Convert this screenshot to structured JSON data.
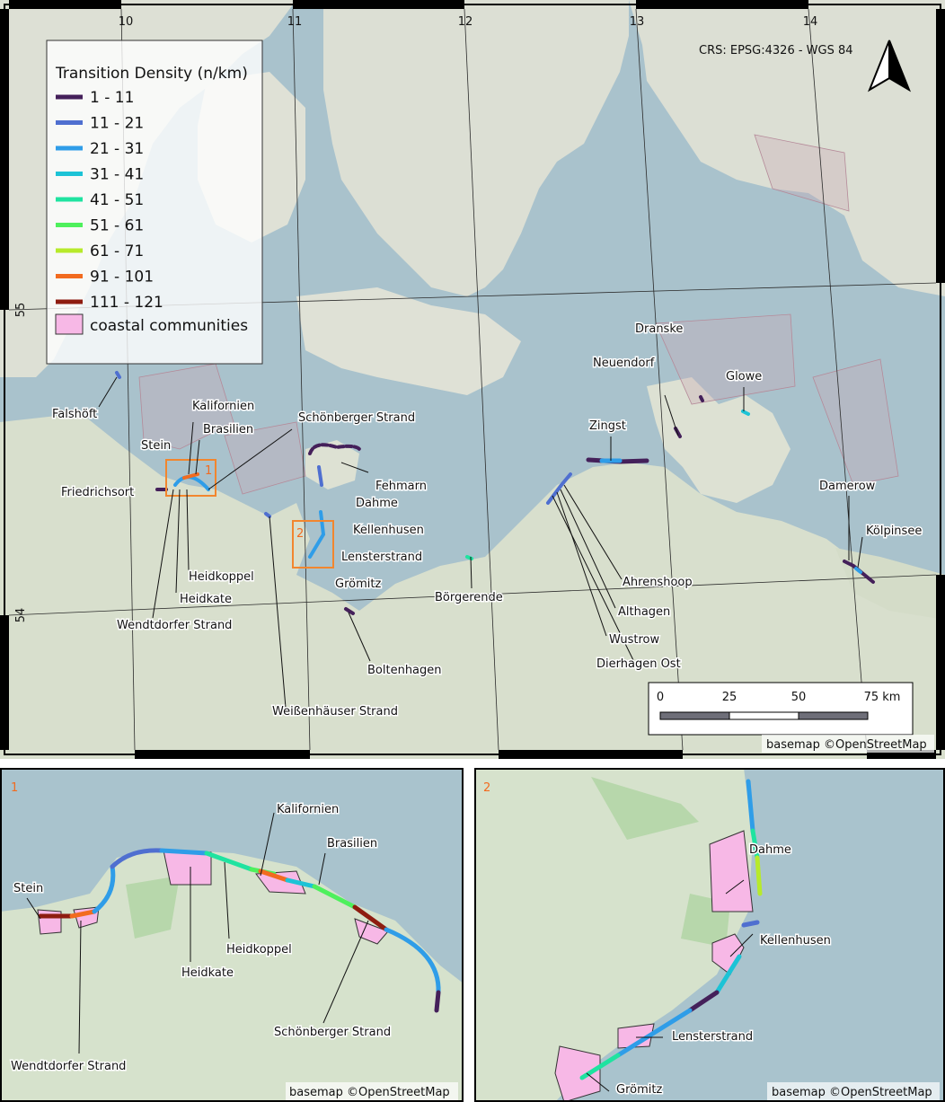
{
  "main_map": {
    "crs": "CRS: EPSG:4326 - WGS 84",
    "basemap_credit": "basemap ©OpenStreetMap",
    "lon_ticks": [
      "10",
      "11",
      "12",
      "13",
      "14"
    ],
    "lat_ticks": [
      "55",
      "54"
    ],
    "north_arrow": "north-arrow-icon",
    "scale_bar": {
      "labels": [
        "0",
        "25",
        "50",
        "75 km"
      ]
    },
    "legend": {
      "title": "Transition Density (n/km)",
      "items": [
        {
          "label": "1 - 11",
          "color": "#44205a"
        },
        {
          "label": "11 - 21",
          "color": "#4f6fd0"
        },
        {
          "label": "21 - 31",
          "color": "#2f9de8"
        },
        {
          "label": "31 - 41",
          "color": "#1cc3d6"
        },
        {
          "label": "41 - 51",
          "color": "#1fe3a0"
        },
        {
          "label": "51 - 61",
          "color": "#4ef05c"
        },
        {
          "label": "61 - 71",
          "color": "#b7ea2b"
        },
        {
          "label": "91 - 101",
          "color": "#f26b1f"
        },
        {
          "label": "111 - 121",
          "color": "#8e1c10"
        }
      ],
      "communities": {
        "label": "coastal communities",
        "color": "#f7b8e6"
      }
    },
    "places": [
      "Falshöft",
      "Kalifornien",
      "Brasilien",
      "Stein",
      "Friedrichsort",
      "Schönberger Strand",
      "Fehmarn",
      "Dahme",
      "Kellenhusen",
      "Lensterstrand",
      "Grömitz",
      "Heidkoppel",
      "Heidkate",
      "Wendtdorfer Strand",
      "Weißenhäuser Strand",
      "Boltenhagen",
      "Börgerende",
      "Zingst",
      "Neuendorf",
      "Dranske",
      "Glowe",
      "Ahrenshoop",
      "Althagen",
      "Wustrow",
      "Dierhagen Ost",
      "Damerow",
      "Kölpinsee"
    ],
    "inset_boxes": [
      "1",
      "2"
    ]
  },
  "inset1": {
    "number": "1",
    "credit": "basemap ©OpenStreetMap",
    "places": [
      "Stein",
      "Wendtdorfer Strand",
      "Heidkate",
      "Heidkoppel",
      "Kalifornien",
      "Brasilien",
      "Schönberger Strand"
    ]
  },
  "inset2": {
    "number": "2",
    "credit": "basemap ©OpenStreetMap",
    "places": [
      "Dahme",
      "Kellenhusen",
      "Lensterstrand",
      "Grömitz"
    ]
  }
}
